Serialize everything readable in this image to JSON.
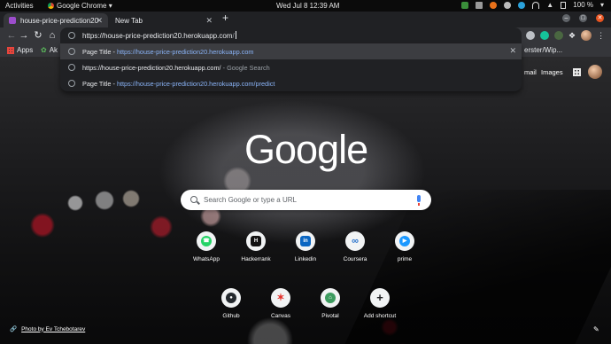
{
  "topbar": {
    "activities": "Activities",
    "app_name": "Google Chrome ▾",
    "clock": "Wed Jul 8  12:39 AM",
    "battery": "100 %"
  },
  "tabs": [
    {
      "title": "house-price-prediction20",
      "active": true
    },
    {
      "title": "New Tab",
      "active": false
    }
  ],
  "omnibox": {
    "host": "https://house-price-prediction20.herokuapp.com",
    "path": "/"
  },
  "bookmarks": {
    "apps": "Apps",
    "item1": "Ak",
    "item2": "erster/Wip..."
  },
  "suggestions": [
    {
      "prefix": "Page Title - ",
      "url": "https://house-price-prediction20.herokuapp.com",
      "suffix": "",
      "selected": true
    },
    {
      "prefix": "https://house-price-prediction20.herokuapp.com/",
      "url": "",
      "suffix": " - Google Search",
      "selected": false
    },
    {
      "prefix": "Page Title - ",
      "url": "https://house-price-prediction20.herokuapp.com/predict",
      "suffix": "",
      "selected": false
    }
  ],
  "google_header": {
    "gmail": "mail",
    "images": "Images"
  },
  "logo": {
    "letters": [
      "G",
      "o",
      "o",
      "g",
      "l",
      "e"
    ]
  },
  "search": {
    "placeholder": "Search Google or type a URL"
  },
  "shortcuts": [
    {
      "label": "WhatsApp",
      "icon": "whatsapp-icon",
      "glyph": "☎",
      "color": "#25d366"
    },
    {
      "label": "Hackerrank",
      "icon": "hackerrank-icon",
      "glyph": "H",
      "color": "#111111"
    },
    {
      "label": "Linkedin",
      "icon": "linkedin-icon",
      "glyph": "in",
      "color": "#0a66c2"
    },
    {
      "label": "Coursera",
      "icon": "coursera-icon",
      "glyph": "∞",
      "color": "#2a73cc"
    },
    {
      "label": "prime",
      "icon": "prime-video-icon",
      "glyph": "▶",
      "color": "#1a98ff"
    },
    {
      "label": "Github",
      "icon": "github-icon",
      "glyph": "●",
      "color": "#24292e"
    },
    {
      "label": "Canvas",
      "icon": "canvas-icon",
      "glyph": "✶",
      "color": "#e4312b"
    },
    {
      "label": "Pivotal",
      "icon": "pivotal-icon",
      "glyph": "⌂",
      "color": "#3d9b5f"
    },
    {
      "label": "Add shortcut",
      "icon": "add-icon",
      "glyph": "+",
      "color": "#202124"
    }
  ],
  "footer": {
    "photo_credit": "Photo by Ev Tchebotarev"
  }
}
